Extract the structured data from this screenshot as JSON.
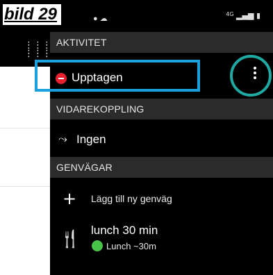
{
  "caption": "bild 29",
  "status_bar": {
    "network": "4G"
  },
  "activity_header": "AKTIVITET",
  "current_status": {
    "label": "Upptagen",
    "color": "#e8212e"
  },
  "forwarding_header": "VIDAREKOPPLING",
  "forwarding_value": "Ingen",
  "shortcuts_header": "GENVÄGAR",
  "add_shortcut_label": "Lägg till ny genväg",
  "shortcut": {
    "title": "lunch 30 min",
    "subtitle": "Lunch ~30m",
    "status_color": "#49c44a"
  },
  "annotation_colors": {
    "highlight_box": "#1aa0df",
    "circle": "#1fa9a3"
  }
}
